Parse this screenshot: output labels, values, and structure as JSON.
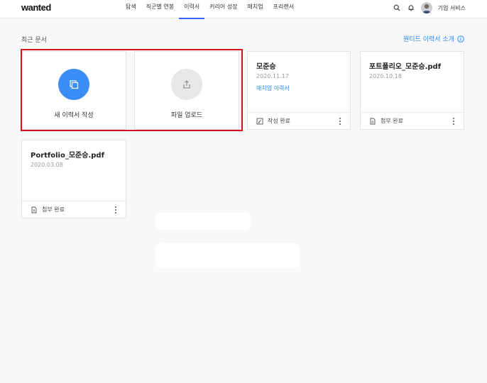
{
  "header": {
    "logo": "wanted",
    "nav": [
      "탐색",
      "직군별 연봉",
      "이력서",
      "커리어 성장",
      "매치업",
      "프리랜서"
    ],
    "active_nav": "이력서",
    "corp_service": "기업 서비스"
  },
  "section": {
    "title": "최근 문서",
    "intro_link": "원티드 이력서 소개"
  },
  "actions": {
    "new_resume": "새 이력서 작성",
    "file_upload": "파일 업로드"
  },
  "documents": [
    {
      "title": "모준승",
      "date": "2020.11.17",
      "match": "매치업 이력서",
      "status": "작성 완료"
    },
    {
      "title": "포트폴리오_모준승.pdf",
      "date": "2020.10.18",
      "status": "첨부 완료"
    },
    {
      "title": "Portfolio_모준승.pdf",
      "date": "2020.03.08",
      "status": "첨부 완료"
    }
  ],
  "colors": {
    "accent": "#258bf7",
    "highlight": "#d6101a"
  }
}
